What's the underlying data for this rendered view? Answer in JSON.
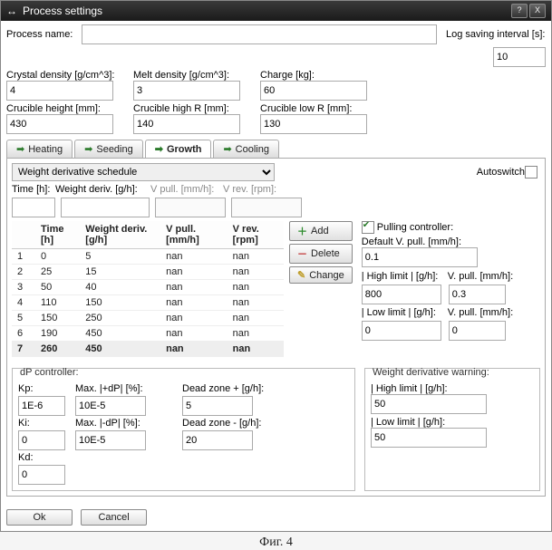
{
  "window": {
    "title": "Process settings"
  },
  "top": {
    "process_name_label": "Process name:",
    "process_name_value": "",
    "log_label": "Log saving interval [s]:",
    "log_value": "10"
  },
  "params1": {
    "crystal_density_label": "Crystal density [g/cm^3]:",
    "crystal_density": "4",
    "melt_density_label": "Melt density [g/cm^3]:",
    "melt_density": "3",
    "charge_label": "Charge [kg]:",
    "charge": "60",
    "crucible_height_label": "Crucible height [mm]:",
    "crucible_height": "430",
    "crucible_high_r_label": "Crucible high R [mm]:",
    "crucible_high_r": "140",
    "crucible_low_r_label": "Crucible low R [mm]:",
    "crucible_low_r": "130"
  },
  "tabs": [
    "Heating",
    "Seeding",
    "Growth",
    "Cooling"
  ],
  "growth": {
    "combo": "Weight derivative schedule",
    "autoswitch": "Autoswitch",
    "inline": {
      "time_label": "Time [h]:",
      "time": "",
      "wd_label": "Weight deriv. [g/h]:",
      "wd": "",
      "vpull_label": "V pull. [mm/h]:",
      "vpull": "",
      "vrev_label": "V rev. [rpm]:",
      "vrev": ""
    },
    "headers": [
      "",
      "Time [h]",
      "Weight deriv. [g/h]",
      "V pull. [mm/h]",
      "V rev. [rpm]"
    ],
    "rows": [
      {
        "n": "1",
        "t": "0",
        "wd": "5",
        "vp": "nan",
        "vr": "nan"
      },
      {
        "n": "2",
        "t": "25",
        "wd": "15",
        "vp": "nan",
        "vr": "nan"
      },
      {
        "n": "3",
        "t": "50",
        "wd": "40",
        "vp": "nan",
        "vr": "nan"
      },
      {
        "n": "4",
        "t": "110",
        "wd": "150",
        "vp": "nan",
        "vr": "nan"
      },
      {
        "n": "5",
        "t": "150",
        "wd": "250",
        "vp": "nan",
        "vr": "nan"
      },
      {
        "n": "6",
        "t": "190",
        "wd": "450",
        "vp": "nan",
        "vr": "nan"
      },
      {
        "n": "7",
        "t": "260",
        "wd": "450",
        "vp": "nan",
        "vr": "nan"
      }
    ],
    "buttons": {
      "add": "Add",
      "delete": "Delete",
      "change": "Change"
    }
  },
  "pulling": {
    "title": "Pulling controller:",
    "default_vpull_label": "Default V. pull. [mm/h]:",
    "default_vpull": "0.1",
    "high_limit_label": "| High limit |",
    "gh": "[g/h]:",
    "high_limit": "800",
    "vpull_label": "V. pull.",
    "mmh": "[mm/h]:",
    "vpull": "0.3",
    "low_limit_label": "| Low limit |",
    "low_limit": "0",
    "vpull_low": "0"
  },
  "dp": {
    "title": "dP controller:",
    "kp_label": "Kp:",
    "kp": "1E-6",
    "max_pdp_label": "Max. |+dP|",
    "pct": "[%]:",
    "max_pdp": "10E-5",
    "dz_plus_label": "Dead zone +",
    "gh": "[g/h]:",
    "dz_plus": "5",
    "ki_label": "Ki:",
    "ki": "0",
    "max_mdp_label": "Max. |-dP|",
    "max_mdp": "10E-5",
    "dz_minus_label": "Dead zone -",
    "dz_minus": "20",
    "kd_label": "Kd:",
    "kd": "0"
  },
  "warning": {
    "title": "Weight derivative warning:",
    "high_label": "| High limit |",
    "gh": "[g/h]:",
    "high": "50",
    "low_label": "| Low limit |",
    "low": "50"
  },
  "footer": {
    "ok": "Ok",
    "cancel": "Cancel"
  },
  "caption": "Фиг. 4"
}
